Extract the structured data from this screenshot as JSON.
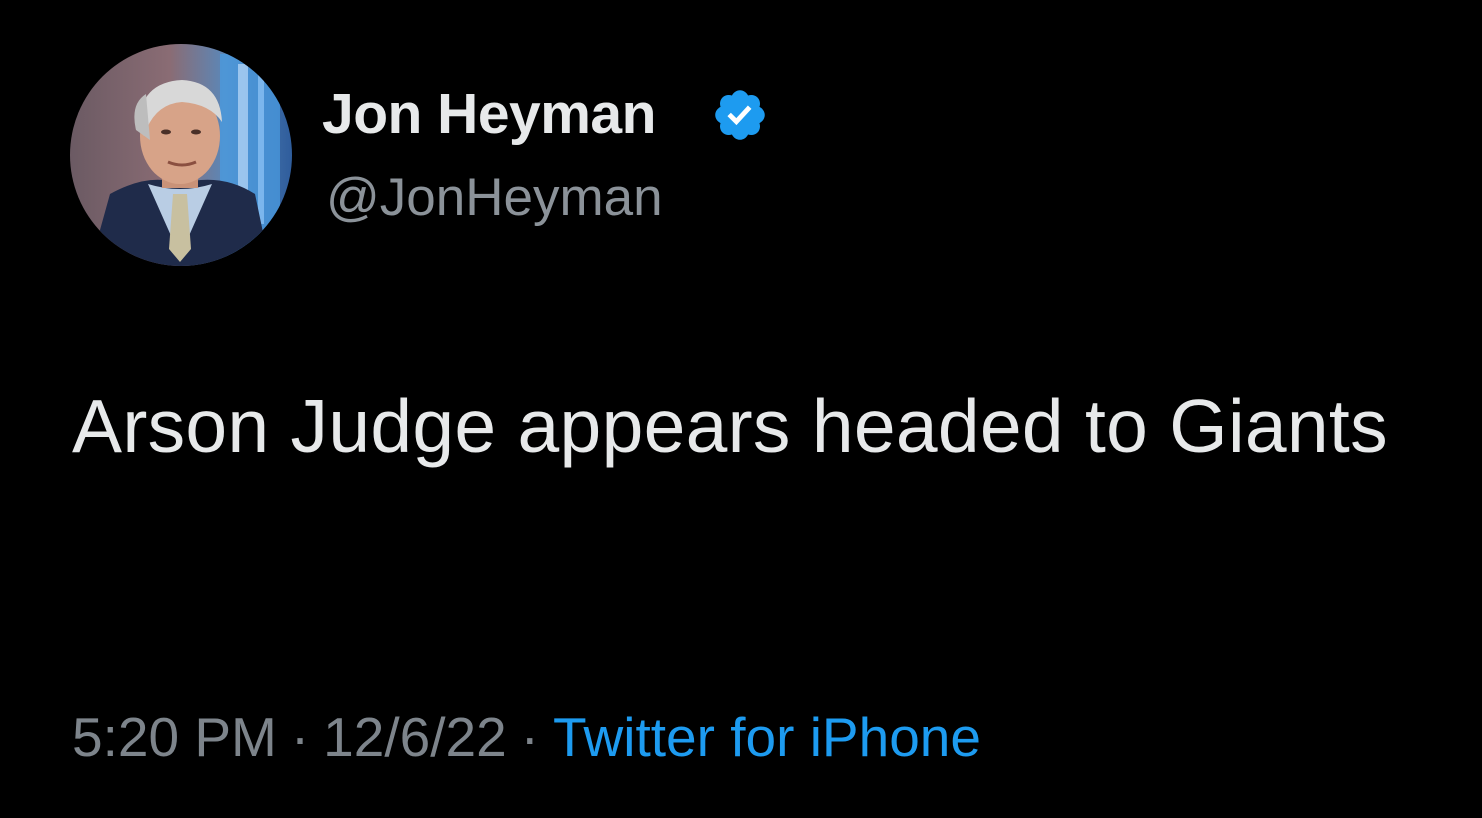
{
  "tweet": {
    "author": {
      "display_name": "Jon Heyman",
      "handle": "@JonHeyman",
      "verified": true,
      "verified_icon": "verified-badge-icon",
      "avatar": "profile-photo"
    },
    "text": "Arson Judge appears headed to Giants",
    "time": "5:20 PM",
    "separator": "·",
    "date": "12/6/22",
    "source": "Twitter for iPhone"
  },
  "colors": {
    "background": "#000000",
    "primary_text": "#e7e9ea",
    "secondary_text": "#8b9299",
    "accent": "#1d9bf0"
  }
}
